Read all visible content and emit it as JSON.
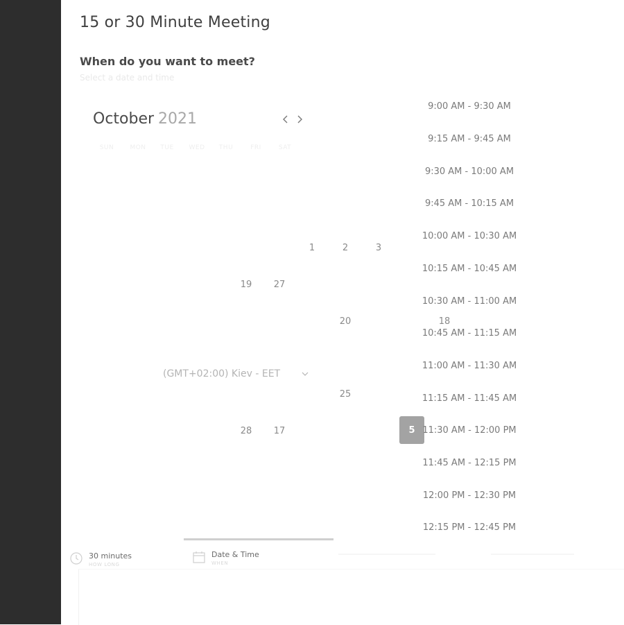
{
  "meeting": {
    "title": "15 or 30 Minute Meeting",
    "prompt": "When do you want to meet?",
    "hint": "Select a date and time"
  },
  "calendar": {
    "month": "October",
    "year": "2021",
    "prev_icon": "chevron-left-icon",
    "next_icon": "chevron-right-icon",
    "weekdays": [
      "SUN",
      "MON",
      "TUE",
      "WED",
      "THU",
      "FRI",
      "SAT"
    ],
    "visible_days": [
      "1",
      "2",
      "3",
      "19",
      "27",
      "20",
      "18",
      "25",
      "28",
      "17",
      "5"
    ],
    "selected_day": "5"
  },
  "timezone": {
    "value": "(GMT+02:00) Kiev - EET",
    "icon": "chevron-down-icon"
  },
  "time_slots": [
    "9:00 AM - 9:30 AM",
    "9:15 AM - 9:45 AM",
    "9:30 AM - 10:00 AM",
    "9:45 AM - 10:15 AM",
    "10:00 AM - 10:30 AM",
    "10:15 AM - 10:45 AM",
    "10:30 AM - 11:00 AM",
    "10:45 AM - 11:15 AM",
    "11:00 AM - 11:30 AM",
    "11:15 AM - 11:45 AM",
    "11:30 AM - 12:00 PM",
    "11:45 AM - 12:15 PM",
    "12:00 PM - 12:30 PM",
    "12:15 PM - 12:45 PM"
  ],
  "info": {
    "duration": {
      "label": "30 minutes",
      "sub": "HOW LONG",
      "icon": "clock-icon"
    },
    "date_time": {
      "label": "Date & Time",
      "sub": "WHEN",
      "icon": "calendar-icon"
    }
  },
  "colors": {
    "sidebar": "#2d2d2d",
    "selected_day_bg": "#a3a3a3",
    "active_tab_line": "#cfcfcf"
  }
}
